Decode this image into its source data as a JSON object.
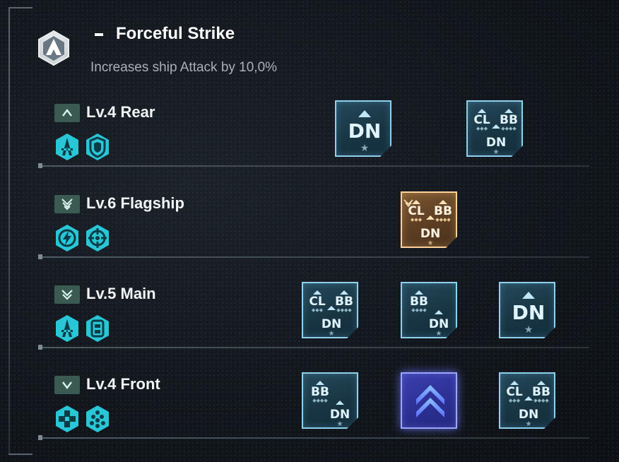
{
  "skill": {
    "title": "Forceful Strike",
    "description": "Increases ship Attack by 10,0%",
    "icon": "hexagon-arrow-icon"
  },
  "rows": [
    {
      "level_label": "Lv.4 Rear",
      "position_icon": "chevron-up-icon",
      "ship_icons": [
        "carrier-ship-icon",
        "shield-ship-icon"
      ],
      "cards": [
        {
          "variant": "blue",
          "type": "DN",
          "labels": [
            "DN"
          ]
        },
        {
          "variant": "blue",
          "type": "CL-BB-DN",
          "labels": [
            "CL",
            "BB",
            "DN"
          ]
        }
      ]
    },
    {
      "level_label": "Lv.6 Flagship",
      "position_icon": "triple-chevron-down-icon",
      "ship_icons": [
        "lightning-ship-icon",
        "crosshair-ship-icon"
      ],
      "cards": [
        {
          "variant": "gold",
          "type": "CL-BB-DN",
          "labels": [
            "CL",
            "BB",
            "DN"
          ]
        }
      ]
    },
    {
      "level_label": "Lv.5 Main",
      "position_icon": "double-chevron-down-icon",
      "ship_icons": [
        "carrier-ship-icon",
        "armor-ship-icon"
      ],
      "cards": [
        {
          "variant": "blue",
          "type": "CL-BB-DN",
          "labels": [
            "CL",
            "BB",
            "DN"
          ]
        },
        {
          "variant": "blue",
          "type": "BB-DN",
          "labels": [
            "BB",
            "DN"
          ]
        },
        {
          "variant": "blue",
          "type": "DN",
          "labels": [
            "DN"
          ]
        }
      ]
    },
    {
      "level_label": "Lv.4 Front",
      "position_icon": "chevron-down-icon",
      "ship_icons": [
        "cross-ship-icon",
        "swarm-ship-icon"
      ],
      "cards": [
        {
          "variant": "blue",
          "type": "BB-DN",
          "labels": [
            "BB",
            "DN"
          ]
        },
        {
          "variant": "purple",
          "type": "rank-up",
          "labels": []
        },
        {
          "variant": "blue",
          "type": "CL-BB-DN",
          "labels": [
            "CL",
            "BB",
            "DN"
          ]
        }
      ]
    }
  ],
  "colors": {
    "accent_cyan": "#29c6d8",
    "card_blue": "#8fd0ee",
    "card_gold": "#ffd29a",
    "card_purple": "#9aa6ff"
  }
}
